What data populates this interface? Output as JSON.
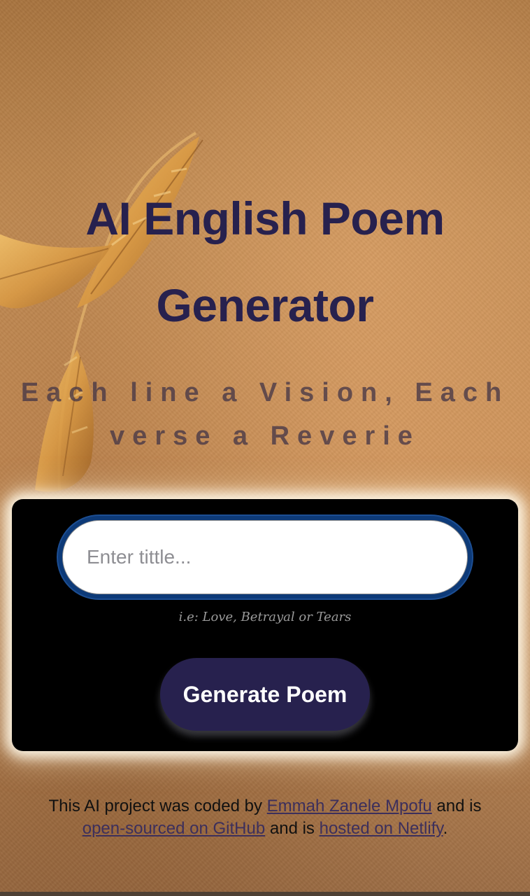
{
  "header": {
    "title": "AI English Poem Generator",
    "subtitle": "Each line a Vision, Each verse a Reverie"
  },
  "form": {
    "input_placeholder": "Enter tittle...",
    "input_value": "",
    "hint": "i.e: Love, Betrayal or Tears",
    "button_label": "Generate Poem"
  },
  "footer": {
    "text_1": "This AI project was coded by ",
    "author_link": "Emmah Zanele Mpofu",
    "text_2": " and is ",
    "github_link": "open-sourced on GitHub",
    "text_3": " and is ",
    "netlify_link": "hosted on Netlify",
    "text_4": "."
  },
  "colors": {
    "accent": "#27214e",
    "panel_bg": "#000000",
    "input_border": "#0d3a78"
  },
  "icons": {
    "background_decoration": "feather-leaf-illustration"
  }
}
